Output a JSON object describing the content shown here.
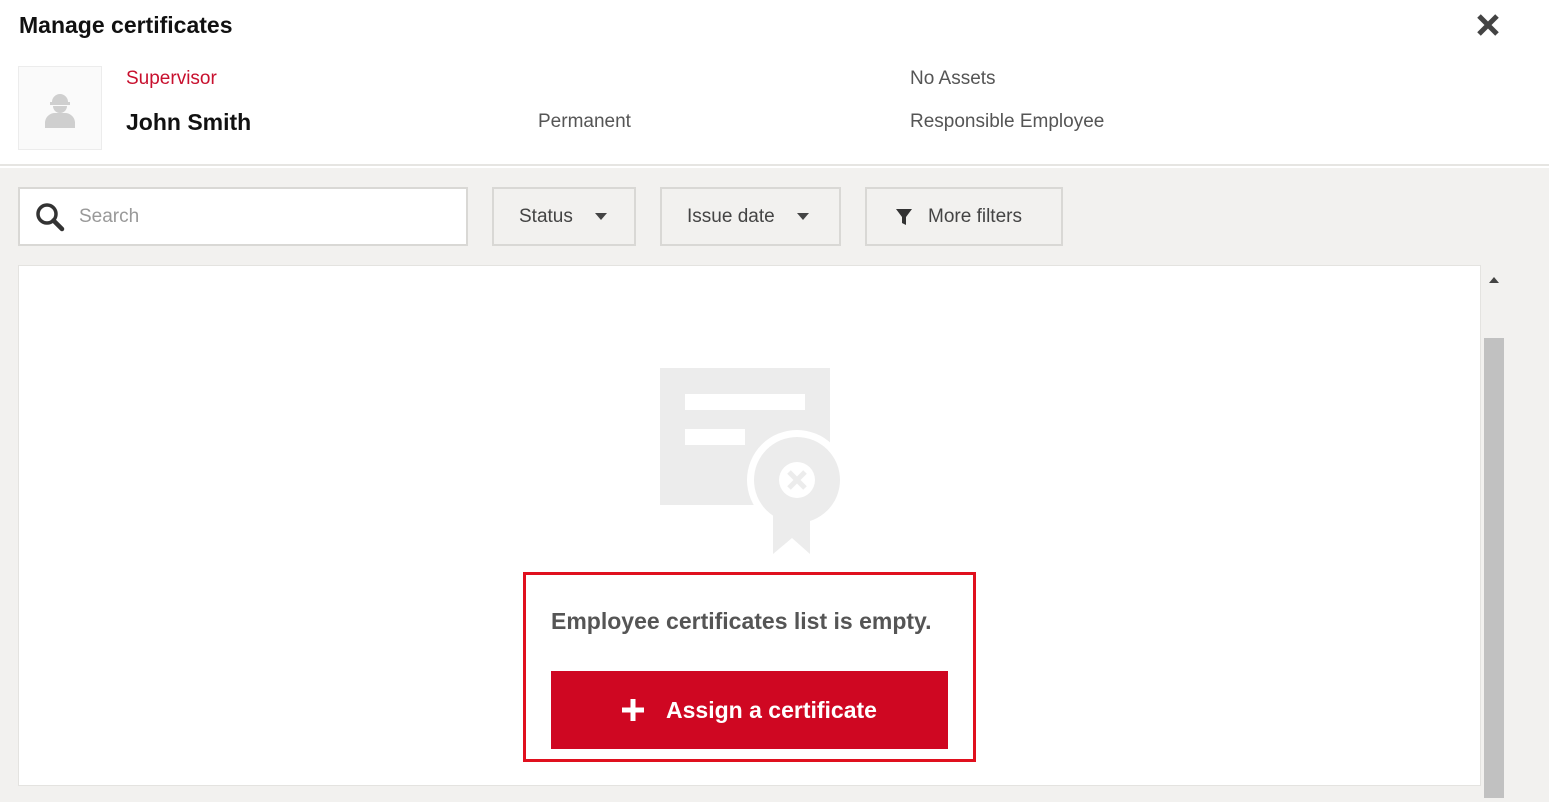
{
  "dialog": {
    "title": "Manage certificates",
    "close_icon": "close-icon"
  },
  "employee": {
    "avatar_icon": "worker-avatar-icon",
    "role": "Supervisor",
    "name": "John Smith",
    "employment_type": "Permanent",
    "assets": "No Assets",
    "responsibility": "Responsible Employee"
  },
  "toolbar": {
    "search": {
      "placeholder": "Search",
      "value": "",
      "icon": "search-icon"
    },
    "status_label": "Status",
    "issue_date_label": "Issue date",
    "more_filters_label": "More filters",
    "more_filters_icon": "funnel-icon"
  },
  "empty_state": {
    "illustration_icon": "certificate-missing-icon",
    "message": "Employee certificates list is empty.",
    "assign_button_label": "Assign a certificate",
    "assign_button_icon": "plus-icon"
  },
  "colors": {
    "accent_red": "#cf0722",
    "role_red": "#c8102e",
    "highlight_border": "#e0101e",
    "background_gray": "#f2f1ef"
  }
}
